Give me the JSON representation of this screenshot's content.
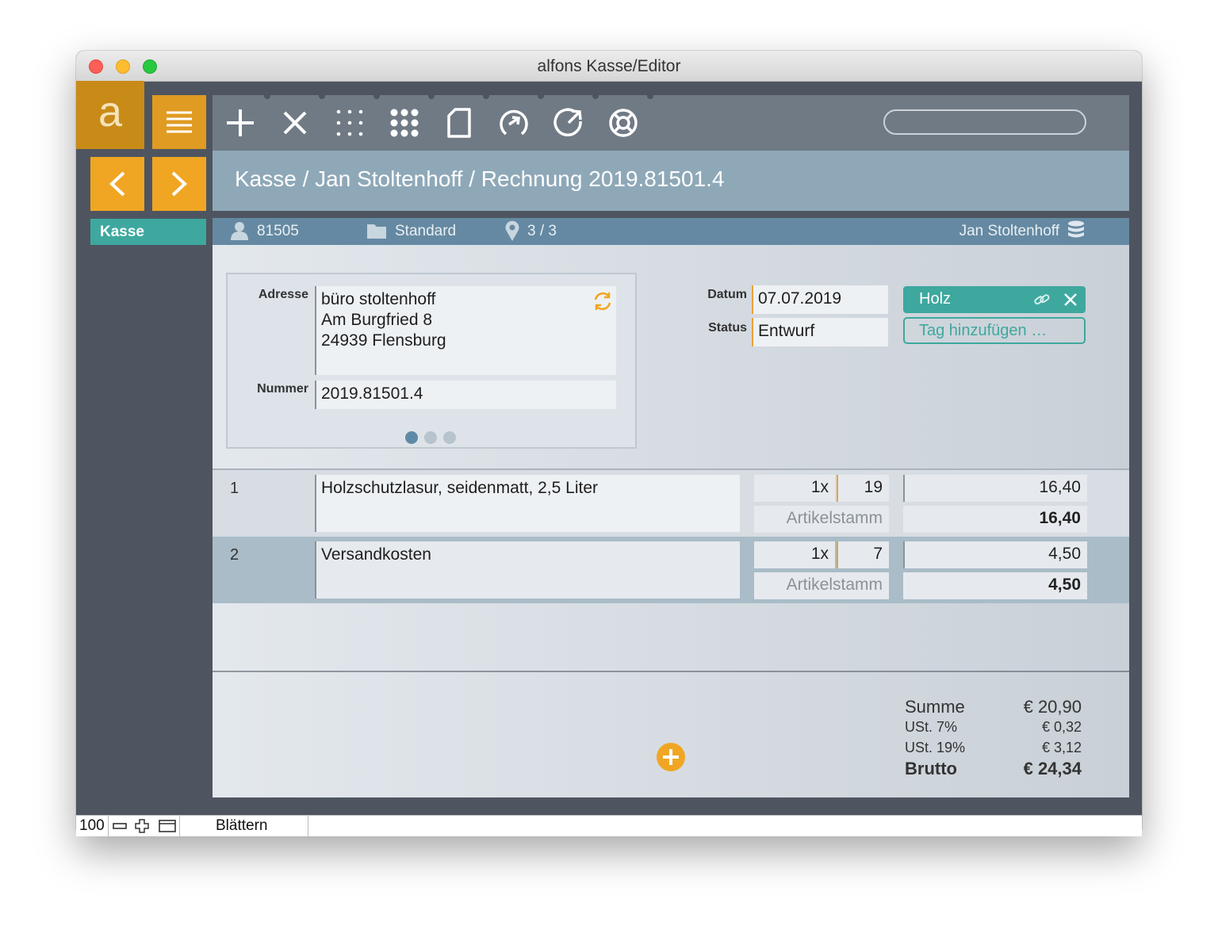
{
  "window": {
    "title": "alfons Kasse/Editor"
  },
  "sidebar": {
    "logo_letter": "a",
    "section_label": "Kasse"
  },
  "breadcrumb": {
    "text": "Kasse / Jan Stoltenhoff / Rechnung 2019.81501.4"
  },
  "search": {
    "placeholder": ""
  },
  "infobar": {
    "customer_number": "81505",
    "folder": "Standard",
    "location": "3 / 3",
    "user": "Jan Stoltenhoff"
  },
  "form": {
    "address_label": "Adresse",
    "address_lines": [
      "büro stoltenhoff",
      "Am Burgfried 8",
      "24939 Flensburg"
    ],
    "number_label": "Nummer",
    "number_value": "2019.81501.4",
    "date_label": "Datum",
    "date_value": "07.07.2019",
    "status_label": "Status",
    "status_value": "Entwurf",
    "tag": "Holz",
    "add_tag_label": "Tag hinzufügen …"
  },
  "items": [
    {
      "pos": "1",
      "description": "Holzschutzlasur, seidenmatt, 2,5 Liter",
      "quantity": "1x",
      "tax": "19",
      "price": "16,40",
      "source": "Artikelstamm",
      "total": "16,40"
    },
    {
      "pos": "2",
      "description": "Versandkosten",
      "quantity": "1x",
      "tax": "7",
      "price": "4,50",
      "source": "Artikelstamm",
      "total": "4,50"
    }
  ],
  "totals": {
    "sum_label": "Summe",
    "sum_value": "€ 20,90",
    "vat7_label": "USt. 7%",
    "vat7_value": "€ 0,32",
    "vat19_label": "USt. 19%",
    "vat19_value": "€ 3,12",
    "gross_label": "Brutto",
    "gross_value": "€ 24,34"
  },
  "statusbar": {
    "zoom": "100",
    "mode": "Blättern"
  },
  "colors": {
    "accent_orange": "#e8a023",
    "teal": "#3aa8a0",
    "breadcrumb": "#8ea8b8",
    "infobar": "#6589a2"
  }
}
